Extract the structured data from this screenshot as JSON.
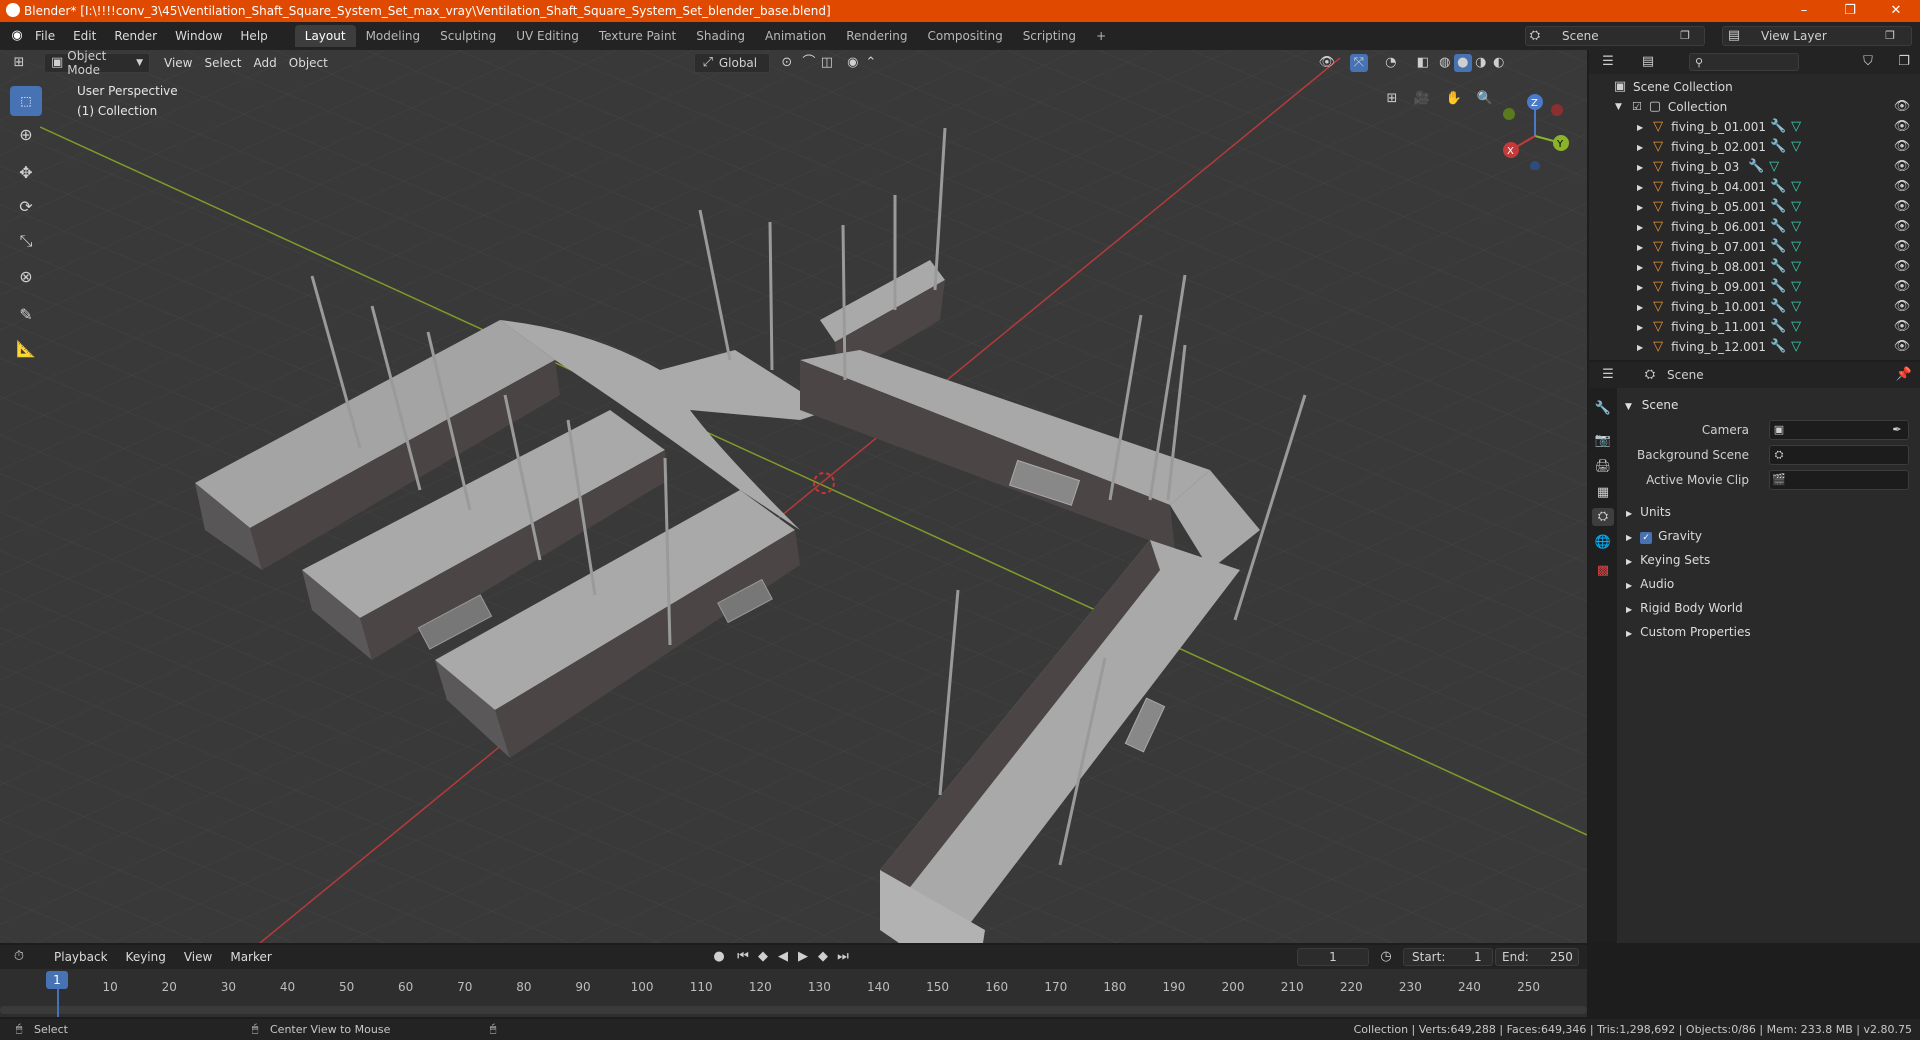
{
  "window": {
    "title": "Blender* [I:\\!!!!conv_3\\45\\Ventilation_Shaft_Square_System_Set_max_vray\\Ventilation_Shaft_Square_System_Set_blender_base.blend]",
    "minimize": "–",
    "maximize": "❐",
    "close": "✕"
  },
  "menu": [
    "File",
    "Edit",
    "Render",
    "Window",
    "Help"
  ],
  "workspaces": [
    "Layout",
    "Modeling",
    "Sculpting",
    "UV Editing",
    "Texture Paint",
    "Shading",
    "Animation",
    "Rendering",
    "Compositing",
    "Scripting",
    "+"
  ],
  "scene_selector": {
    "value": "Scene"
  },
  "view_layer": {
    "value": "View Layer"
  },
  "viewport_header": {
    "mode": "Object Mode",
    "menus": [
      "View",
      "Select",
      "Add",
      "Object"
    ],
    "orientation": "Global"
  },
  "viewport": {
    "perspective": "User Perspective",
    "collection": "(1) Collection"
  },
  "gizmo": {
    "x": "X",
    "y": "Y",
    "z": "Z"
  },
  "outliner": {
    "search_placeholder": "",
    "scene_collection": "Scene Collection",
    "collection": "Collection",
    "objects": [
      "fiving_b_01.001",
      "fiving_b_02.001",
      "fiving_b_03",
      "fiving_b_04.001",
      "fiving_b_05.001",
      "fiving_b_06.001",
      "fiving_b_07.001",
      "fiving_b_08.001",
      "fiving_b_09.001",
      "fiving_b_10.001",
      "fiving_b_11.001",
      "fiving_b_12.001"
    ]
  },
  "properties": {
    "context": "Scene",
    "panel": "Scene",
    "camera_label": "Camera",
    "bg_scene_label": "Background Scene",
    "movie_clip_label": "Active Movie Clip",
    "sections": [
      "Units",
      "Gravity",
      "Keying Sets",
      "Audio",
      "Rigid Body World",
      "Custom Properties"
    ]
  },
  "timeline": {
    "menus": [
      "Playback",
      "Keying",
      "View",
      "Marker"
    ],
    "current_frame": "1",
    "start_label": "Start:",
    "start": "1",
    "end_label": "End:",
    "end": "250",
    "ticks": [
      "1",
      "10",
      "20",
      "30",
      "40",
      "50",
      "60",
      "70",
      "80",
      "90",
      "100",
      "110",
      "120",
      "130",
      "140",
      "150",
      "160",
      "170",
      "180",
      "190",
      "200",
      "210",
      "220",
      "230",
      "240",
      "250"
    ]
  },
  "statusbar": {
    "select": "Select",
    "center": "Center View to Mouse",
    "stats": "Collection | Verts:649,288 | Faces:649,346 | Tris:1,298,692 | Objects:0/86 | Mem: 233.8 MB | v2.80.75"
  },
  "colors": {
    "titlebar": "#e04a00",
    "accent_blue": "#4772b3",
    "grid_bg": "#393939",
    "x_axis": "#c33a3a",
    "y_axis": "#8ab22a"
  }
}
